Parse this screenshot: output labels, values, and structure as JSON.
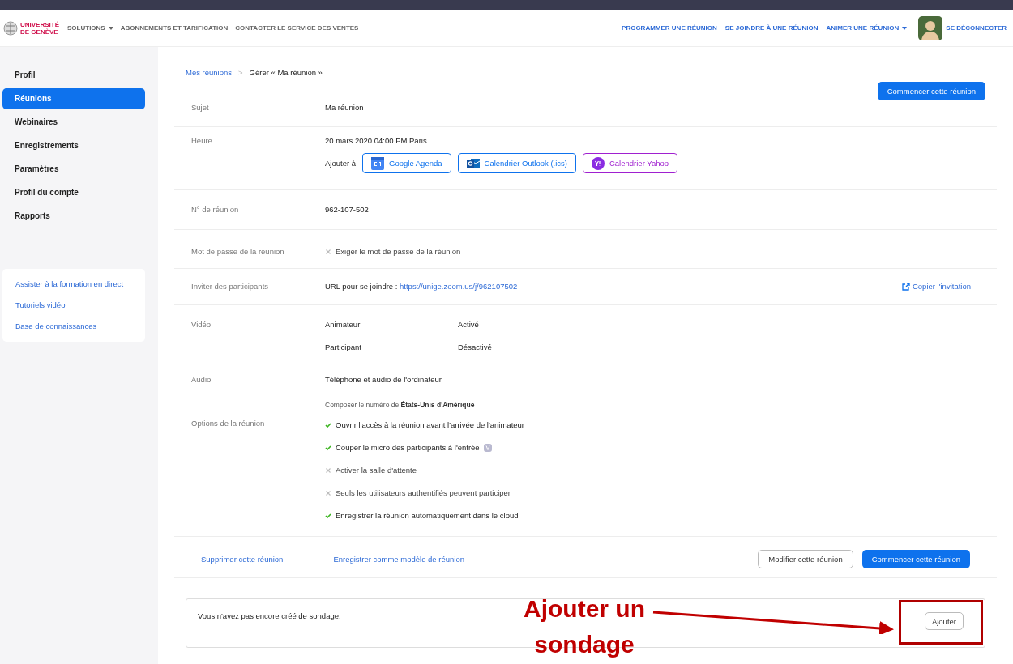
{
  "header": {
    "logo": {
      "line1": "UNIVERSITÉ",
      "line2": "DE GENÈVE"
    },
    "nav_left": [
      {
        "label": "SOLUTIONS",
        "dropdown": true
      },
      {
        "label": "ABONNEMENTS ET TARIFICATION",
        "dropdown": false
      },
      {
        "label": "CONTACTER LE SERVICE DES VENTES",
        "dropdown": false
      }
    ],
    "nav_right": [
      {
        "label": "PROGRAMMER UNE RÉUNION",
        "dropdown": false
      },
      {
        "label": "SE JOINDRE À UNE RÉUNION",
        "dropdown": false
      },
      {
        "label": "ANIMER UNE RÉUNION",
        "dropdown": true
      }
    ],
    "signout": "SE DÉCONNECTER"
  },
  "sidebar": {
    "items": [
      {
        "label": "Profil",
        "selected": false
      },
      {
        "label": "Réunions",
        "selected": true
      },
      {
        "label": "Webinaires",
        "selected": false
      },
      {
        "label": "Enregistrements",
        "selected": false
      },
      {
        "label": "Paramètres",
        "selected": false
      },
      {
        "label": "Profil du compte",
        "selected": false
      },
      {
        "label": "Rapports",
        "selected": false
      }
    ],
    "help_links": [
      "Assister à la formation en direct",
      "Tutoriels vidéo",
      "Base de connaissances"
    ]
  },
  "breadcrumb": {
    "parent": "Mes réunions",
    "separator": ">",
    "current": "Gérer « Ma réunion »"
  },
  "start_button_top": "Commencer cette réunion",
  "topic": {
    "label": "Sujet",
    "value": "Ma réunion"
  },
  "time": {
    "label": "Heure",
    "value": "20 mars 2020 04:00 PM Paris",
    "add_to": "Ajouter à",
    "calendars": [
      {
        "kind": "google",
        "label": "Google Agenda",
        "color": "#0e72ed"
      },
      {
        "kind": "outlook",
        "label": "Calendrier Outlook (.ics)",
        "color": "#0e72ed"
      },
      {
        "kind": "yahoo",
        "label": "Calendrier Yahoo",
        "color": "#a020d0"
      }
    ]
  },
  "meeting_id": {
    "label": "N° de réunion",
    "value": "962-107-502"
  },
  "password": {
    "label": "Mot de passe de la réunion",
    "text": "Exiger le mot de passe de la réunion",
    "enabled": false
  },
  "invite": {
    "label": "Inviter des participants",
    "url_label": "URL pour se joindre :",
    "url": "https://unige.zoom.us/j/962107502",
    "copy": "Copier l'invitation"
  },
  "video": {
    "label": "Vidéo",
    "rows": [
      {
        "who": "Animateur",
        "state": "Activé"
      },
      {
        "who": "Participant",
        "state": "Désactivé"
      }
    ]
  },
  "audio": {
    "label": "Audio",
    "value": "Téléphone et audio de l'ordinateur",
    "dial": "Composer le numéro de **États-Unis d'Amérique**"
  },
  "options": {
    "label": "Options de la réunion",
    "items": [
      {
        "text": "Ouvrir l'accès à la réunion avant l'arrivée de l'animateur",
        "enabled": true,
        "badge": false
      },
      {
        "text": "Couper le micro des participants à l'entrée",
        "enabled": true,
        "badge": true
      },
      {
        "text": "Activer la salle d'attente",
        "enabled": false,
        "badge": false
      },
      {
        "text": "Seuls les utilisateurs authentifiés peuvent participer",
        "enabled": false,
        "badge": false
      },
      {
        "text": "Enregistrer la réunion automatiquement dans le cloud",
        "enabled": true,
        "badge": false
      }
    ]
  },
  "actions": {
    "delete": "Supprimer cette réunion",
    "save_template": "Enregistrer comme modèle de réunion",
    "edit": "Modifier cette réunion",
    "start": "Commencer cette réunion"
  },
  "poll": {
    "message": "Vous n'avez pas encore créé de sondage.",
    "add": "Ajouter"
  },
  "annotation": {
    "line1": "Ajouter un",
    "line2": "sondage"
  }
}
